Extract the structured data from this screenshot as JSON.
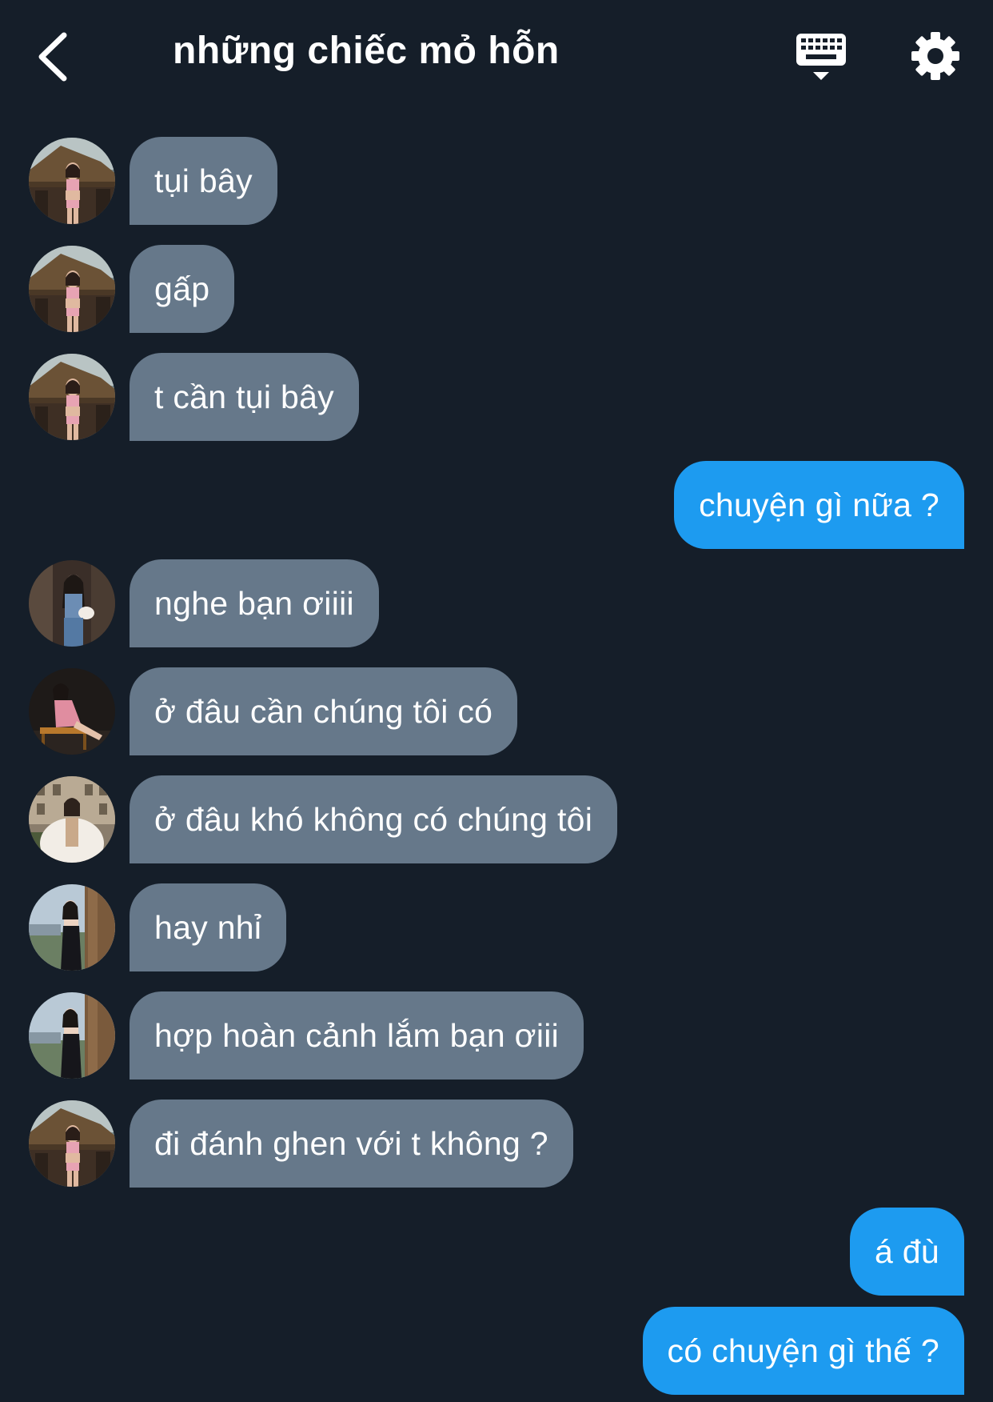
{
  "header": {
    "title": "những chiếc mỏ hỗn"
  },
  "messages": [
    {
      "text": "tụi bây"
    },
    {
      "text": "gấp"
    },
    {
      "text": "t cần tụi bây"
    },
    {
      "text": "chuyện gì nữa ?"
    },
    {
      "text": "nghe bạn ơiiii"
    },
    {
      "text": "ở đâu cần chúng tôi có"
    },
    {
      "text": "ở đâu khó không có chúng tôi"
    },
    {
      "text": "hay nhỉ"
    },
    {
      "text": "hợp hoàn cảnh lắm bạn ơiii"
    },
    {
      "text": "đi đánh ghen với t không ?"
    },
    {
      "text": "á đù"
    },
    {
      "text": "có chuyện gì thế ?"
    }
  ],
  "colors": {
    "background": "#151e29",
    "incoming_bubble": "#66788a",
    "outgoing_bubble": "#1d9bf0",
    "text": "#ffffff"
  },
  "icons": {
    "back": "chevron-left-icon",
    "keyboard": "keyboard-icon",
    "settings": "gear-icon"
  }
}
